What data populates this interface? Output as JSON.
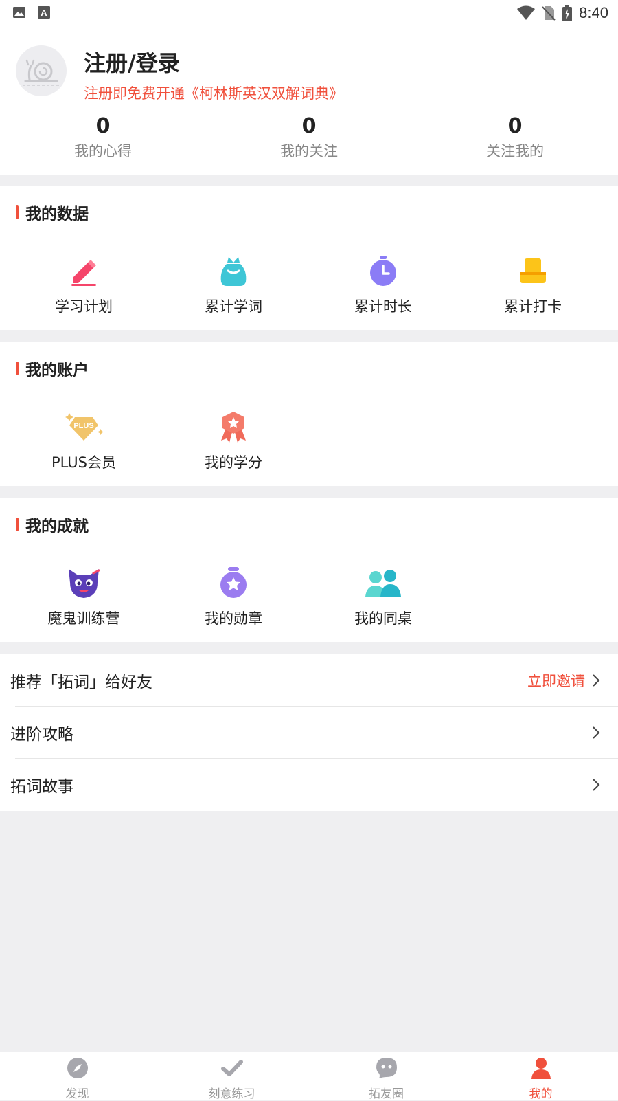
{
  "status_bar": {
    "time": "8:40",
    "left_icons": [
      "image-icon",
      "font-icon"
    ],
    "right_icons": [
      "wifi-icon",
      "no-sim-icon",
      "battery-icon"
    ]
  },
  "profile": {
    "title": "注册/登录",
    "subtitle": "注册即免费开通《柯林斯英汉双解词典》",
    "stats": [
      {
        "value": "0",
        "label": "我的心得"
      },
      {
        "value": "0",
        "label": "我的关注"
      },
      {
        "value": "0",
        "label": "关注我的"
      }
    ]
  },
  "my_data": {
    "title": "我的数据",
    "items": [
      {
        "label": "学习计划",
        "icon": "pencil-icon"
      },
      {
        "label": "累计学词",
        "icon": "bag-icon"
      },
      {
        "label": "累计时长",
        "icon": "stopwatch-icon"
      },
      {
        "label": "累计打卡",
        "icon": "checkin-icon"
      }
    ]
  },
  "my_account": {
    "title": "我的账户",
    "items": [
      {
        "label": "PLUS会员",
        "icon": "plus-diamond-icon",
        "badge": "PLUS"
      },
      {
        "label": "我的学分",
        "icon": "ribbon-badge-icon"
      }
    ]
  },
  "my_achievements": {
    "title": "我的成就",
    "items": [
      {
        "label": "魔鬼训练营",
        "icon": "devil-cat-icon"
      },
      {
        "label": "我的勋章",
        "icon": "medal-icon"
      },
      {
        "label": "我的同桌",
        "icon": "deskmates-icon"
      }
    ]
  },
  "list": [
    {
      "label": "推荐「拓词」给好友",
      "action": "立即邀请"
    },
    {
      "label": "进阶攻略",
      "action": ""
    },
    {
      "label": "拓词故事",
      "action": ""
    }
  ],
  "tabs": [
    {
      "label": "发现",
      "icon": "compass-icon",
      "active": false
    },
    {
      "label": "刻意练习",
      "icon": "check-icon",
      "active": false
    },
    {
      "label": "拓友圈",
      "icon": "chat-bubble-icon",
      "active": false
    },
    {
      "label": "我的",
      "icon": "user-icon",
      "active": true
    }
  ],
  "colors": {
    "accent": "#f0503c",
    "background": "#efeff1",
    "card": "#ffffff",
    "muted": "#888888"
  }
}
